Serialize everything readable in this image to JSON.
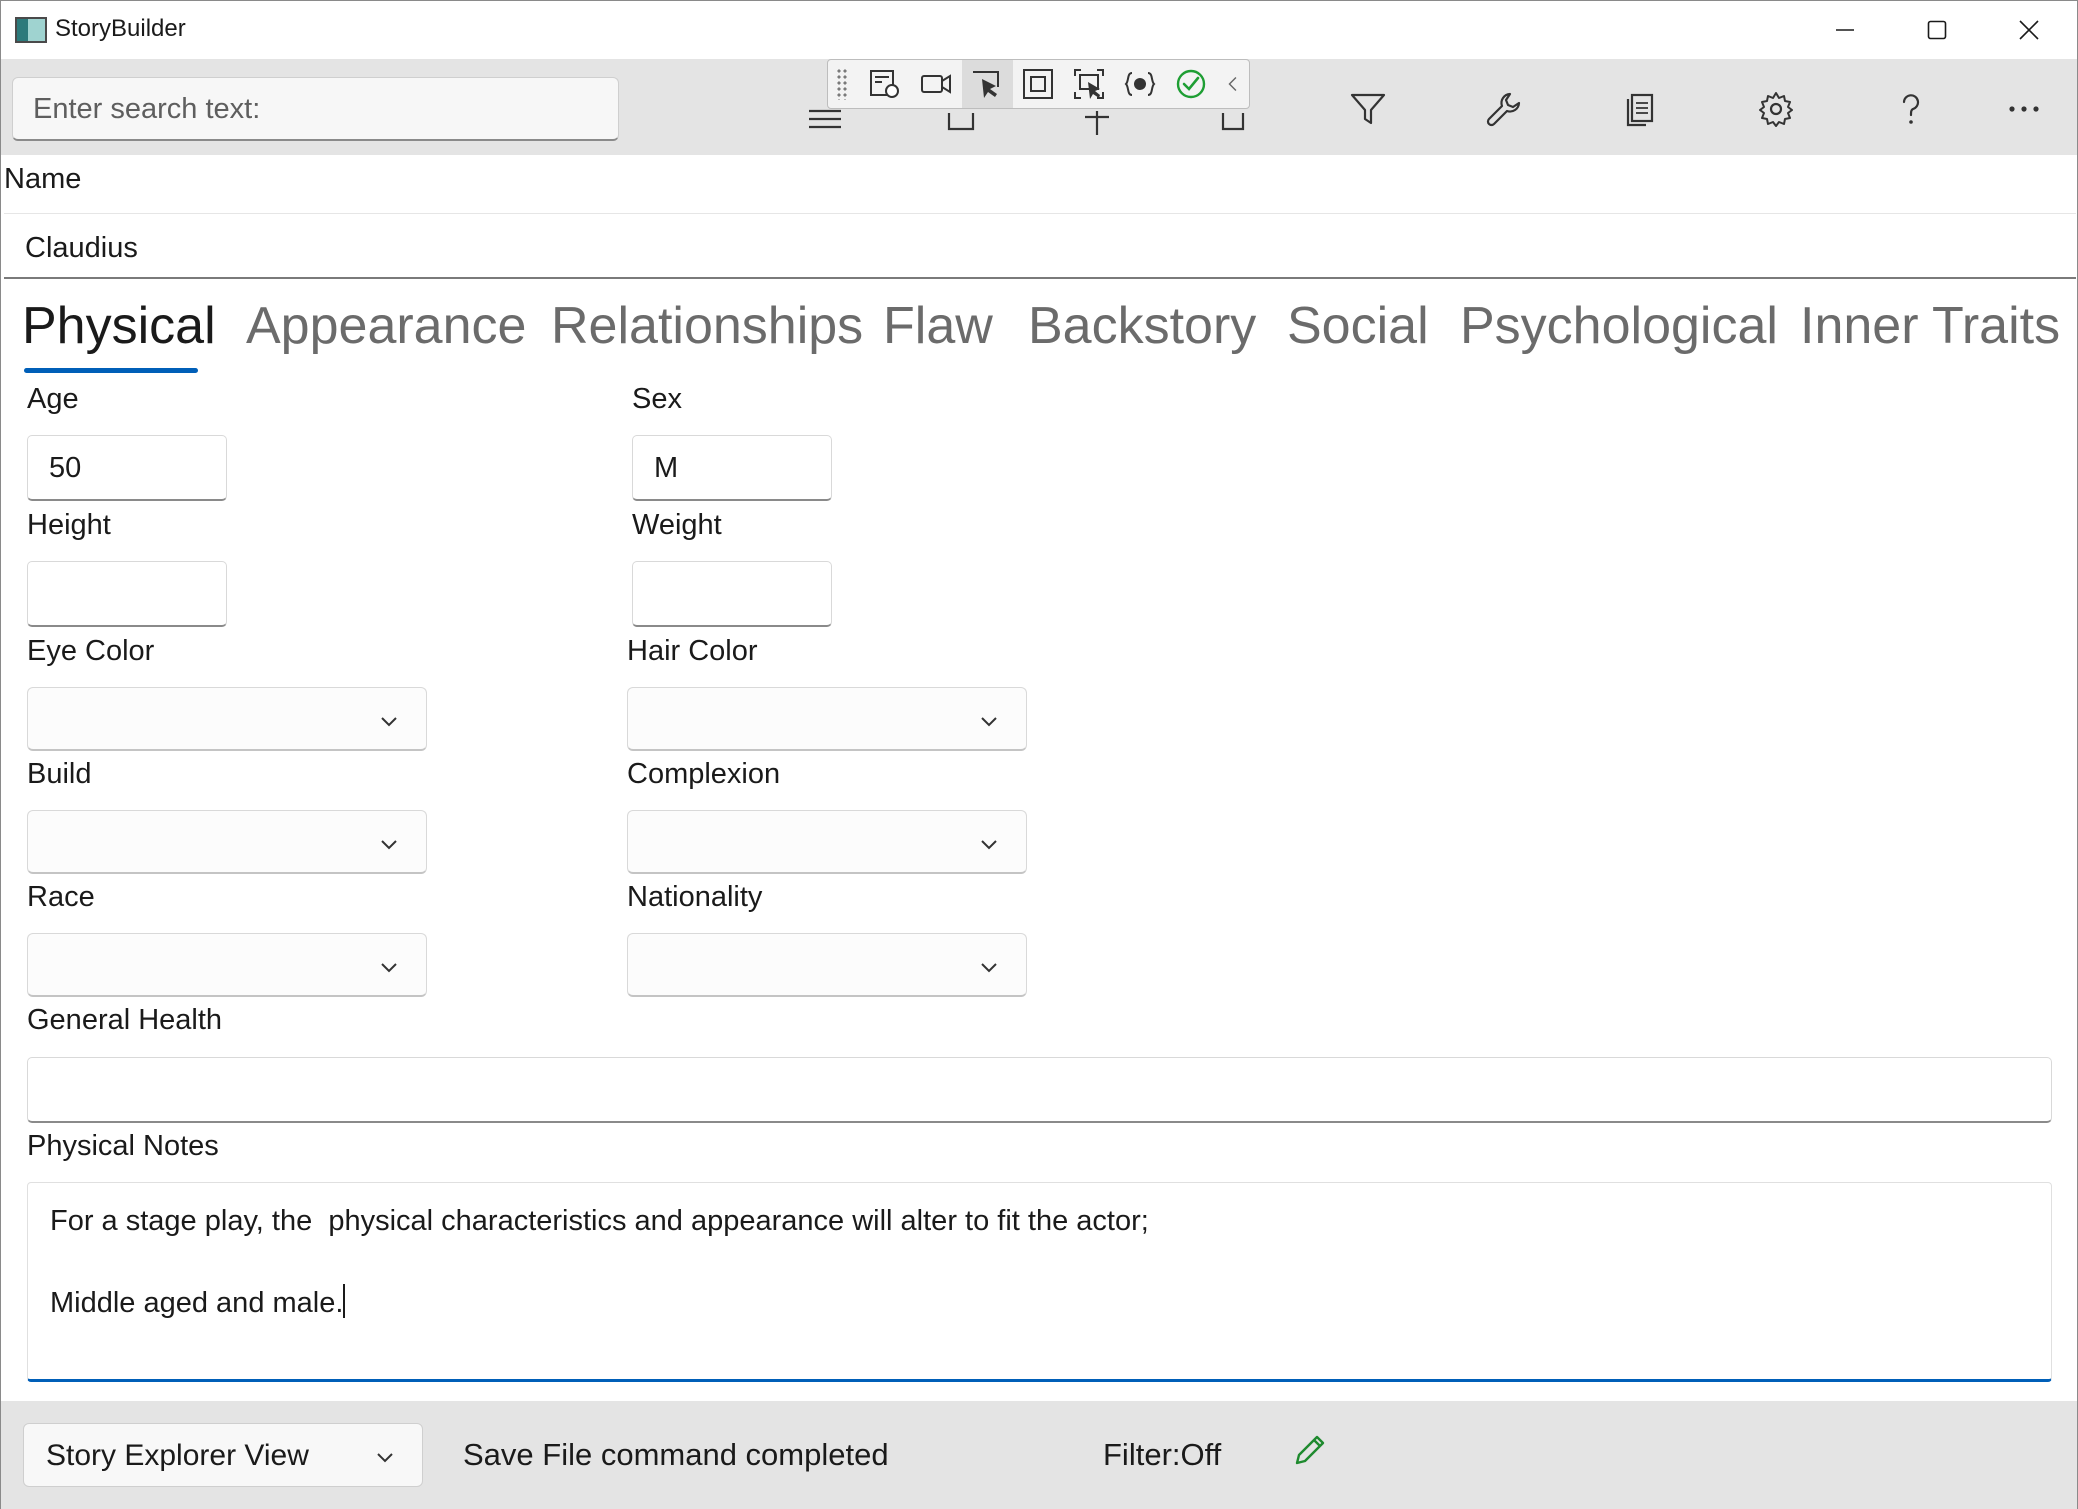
{
  "window": {
    "title": "StoryBuilder",
    "minimize_icon": "minimize-icon",
    "maximize_icon": "maximize-icon",
    "close_icon": "close-icon"
  },
  "toolbar": {
    "search_placeholder": "Enter search text:",
    "icons": [
      "hamburger-menu-icon",
      "add-sibling-icon",
      "add-child-icon",
      "remove-icon",
      "filter-icon",
      "tools-icon",
      "reports-icon",
      "settings-icon",
      "help-icon",
      "more-icon"
    ]
  },
  "debug_toolbar": {
    "icons": [
      "live-visual-tree-icon",
      "record-icon",
      "select-element-icon",
      "display-layout-adorners-icon",
      "track-focus-icon",
      "binding-failures-icon",
      "hot-reload-ok-icon",
      "collapse-icon"
    ]
  },
  "name": {
    "label": "Name",
    "value": "Claudius"
  },
  "tabs": [
    {
      "label": "Physical",
      "active": true
    },
    {
      "label": "Appearance",
      "active": false
    },
    {
      "label": "Relationships",
      "active": false
    },
    {
      "label": "Flaw",
      "active": false
    },
    {
      "label": "Backstory",
      "active": false
    },
    {
      "label": "Social",
      "active": false
    },
    {
      "label": "Psychological",
      "active": false
    },
    {
      "label": "Inner Traits",
      "active": false
    }
  ],
  "form": {
    "age": {
      "label": "Age",
      "value": "50"
    },
    "sex": {
      "label": "Sex",
      "value": "M"
    },
    "height": {
      "label": "Height",
      "value": ""
    },
    "weight": {
      "label": "Weight",
      "value": ""
    },
    "eye_color": {
      "label": "Eye Color",
      "value": ""
    },
    "hair_color": {
      "label": "Hair Color",
      "value": ""
    },
    "build": {
      "label": "Build",
      "value": ""
    },
    "complexion": {
      "label": "Complexion",
      "value": ""
    },
    "race": {
      "label": "Race",
      "value": ""
    },
    "nationality": {
      "label": "Nationality",
      "value": ""
    },
    "general_health": {
      "label": "General Health",
      "value": ""
    },
    "physical_notes": {
      "label": "Physical Notes",
      "line1": "For a stage play, the  physical characteristics and appearance will alter to fit the actor;",
      "line2": "Middle aged and male."
    }
  },
  "statusbar": {
    "view": "Story Explorer View",
    "message": "Save File command completed",
    "filter": "Filter:Off",
    "edit_icon": "pencil-icon"
  },
  "colors": {
    "accent": "#005fb8",
    "toolbar_bg": "#e4e4e4",
    "hot_reload_ok": "#1e9e33",
    "edit_green": "#1e8a2e"
  }
}
